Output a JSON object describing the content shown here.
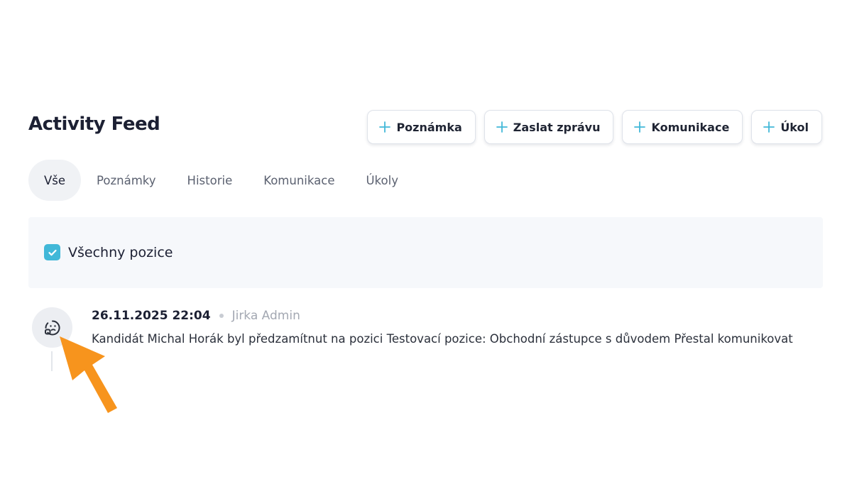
{
  "header": {
    "title": "Activity Feed"
  },
  "actions": [
    {
      "label": "Poznámka",
      "icon": "plus-icon"
    },
    {
      "label": "Zaslat zprávu",
      "icon": "plus-icon"
    },
    {
      "label": "Komunikace",
      "icon": "plus-icon"
    },
    {
      "label": "Úkol",
      "icon": "plus-icon"
    }
  ],
  "tabs": [
    {
      "label": "Vše",
      "active": true
    },
    {
      "label": "Poznámky",
      "active": false
    },
    {
      "label": "Historie",
      "active": false
    },
    {
      "label": "Komunikace",
      "active": false
    },
    {
      "label": "Úkoly",
      "active": false
    }
  ],
  "filter": {
    "checked": true,
    "label": "Všechny pozice"
  },
  "feed": [
    {
      "date": "26.11.2025 22:04",
      "author": "Jirka Admin",
      "message": "Kandidát Michal Horák byl předzamítnut na pozici Testovací pozice: Obchodní zástupce s důvodem Přestal komunikovat",
      "icon": "rejected-face-icon"
    }
  ],
  "colors": {
    "accent": "#41b8d8",
    "pointer": "#f7941d"
  }
}
